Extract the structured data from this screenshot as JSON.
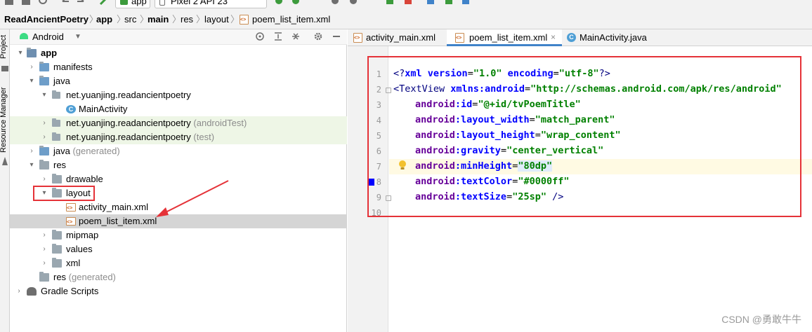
{
  "toolbar": {
    "run_config": "app",
    "device": "Pixel 2 API 23"
  },
  "breadcrumb": [
    "ReadAncientPoetry",
    "app",
    "src",
    "main",
    "res",
    "layout",
    "poem_list_item.xml"
  ],
  "side_strip": {
    "project_label": "Project",
    "resource_manager_label": "Resource Manager"
  },
  "project_panel": {
    "view_selector": "Android",
    "tree": [
      {
        "label": "app",
        "suffix": "",
        "bold": true
      },
      {
        "label": "manifests",
        "suffix": ""
      },
      {
        "label": "java",
        "suffix": ""
      },
      {
        "label": "net.yuanjing.readancientpoetry",
        "suffix": ""
      },
      {
        "label": "MainActivity",
        "suffix": ""
      },
      {
        "label": "net.yuanjing.readancientpoetry",
        "suffix": " (androidTest)"
      },
      {
        "label": "net.yuanjing.readancientpoetry",
        "suffix": " (test)"
      },
      {
        "label": "java",
        "suffix": " (generated)"
      },
      {
        "label": "res",
        "suffix": ""
      },
      {
        "label": "drawable",
        "suffix": ""
      },
      {
        "label": "layout",
        "suffix": ""
      },
      {
        "label": "activity_main.xml",
        "suffix": ""
      },
      {
        "label": "poem_list_item.xml",
        "suffix": ""
      },
      {
        "label": "mipmap",
        "suffix": ""
      },
      {
        "label": "values",
        "suffix": ""
      },
      {
        "label": "xml",
        "suffix": ""
      },
      {
        "label": "res",
        "suffix": " (generated)"
      },
      {
        "label": "Gradle Scripts",
        "suffix": ""
      }
    ]
  },
  "editor": {
    "tabs": [
      {
        "label": "activity_main.xml"
      },
      {
        "label": "poem_list_item.xml",
        "active": true
      },
      {
        "label": "MainActivity.java"
      }
    ],
    "line_numbers": [
      "1",
      "2",
      "3",
      "4",
      "5",
      "6",
      "7",
      "8",
      "9",
      "10"
    ],
    "code": {
      "l1": {
        "p1": "<?",
        "p2": "xml ",
        "p3": "version",
        "p4": "=",
        "p5": "\"1.0\"",
        "p6": " encoding",
        "p7": "=",
        "p8": "\"utf-8\"",
        "p9": "?>"
      },
      "l2": {
        "tag": "<TextView ",
        "attr": "xmlns:android",
        "eq": "=",
        "val": "\"http://schemas.android.com/apk/res/android\""
      },
      "l3": {
        "ns": "android",
        "attr": ":id",
        "eq": "=",
        "val": "\"@+id/tvPoemTitle\""
      },
      "l4": {
        "ns": "android",
        "attr": ":layout_width",
        "eq": "=",
        "val": "\"match_parent\""
      },
      "l5": {
        "ns": "android",
        "attr": ":layout_height",
        "eq": "=",
        "val": "\"wrap_content\""
      },
      "l6": {
        "ns": "android",
        "attr": ":gravity",
        "eq": "=",
        "val": "\"center_vertical\""
      },
      "l7": {
        "ns": "android",
        "attr": ":minHeight",
        "eq": "=",
        "val": "\"80dp\""
      },
      "l8": {
        "ns": "android",
        "attr": ":textColor",
        "eq": "=",
        "val": "\"#0000ff\""
      },
      "l9": {
        "ns": "android",
        "attr": ":textSize",
        "eq": "=",
        "val": "\"25sp\"",
        "end": " />"
      }
    }
  },
  "watermark": "CSDN @勇敢牛牛",
  "colors": {
    "annotation_red": "#e53238",
    "active_tab_underline": "#4083c9",
    "color_swatch": "#0000ff"
  }
}
